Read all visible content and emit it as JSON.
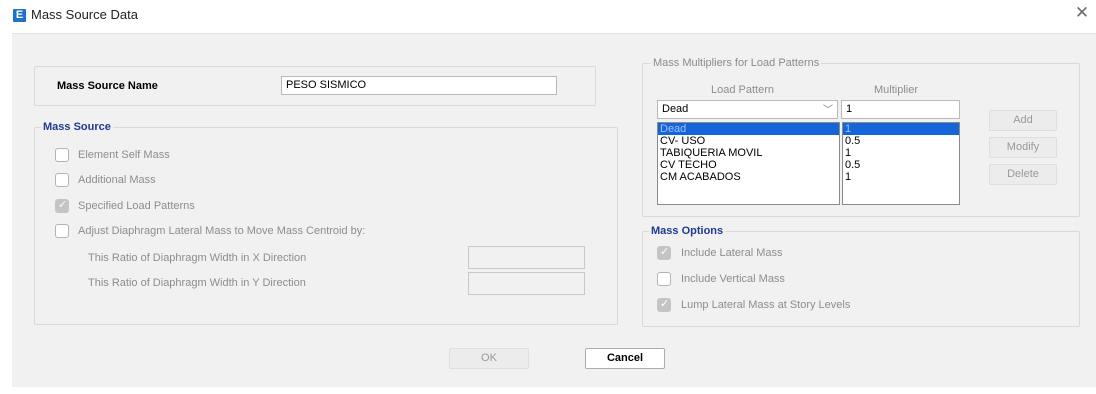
{
  "window": {
    "app_icon": "E",
    "title": "Mass Source Data",
    "close_glyph": "✕"
  },
  "mass_source_name": {
    "label": "Mass Source Name",
    "value": "PESO SISMICO"
  },
  "mass_source": {
    "legend": "Mass Source",
    "element_self_mass": {
      "label": "Element Self Mass",
      "checked": false
    },
    "additional_mass": {
      "label": "Additional Mass",
      "checked": false
    },
    "specified_load_patterns": {
      "label": "Specified Load Patterns",
      "checked": true
    },
    "adjust_diaphragm": {
      "label": "Adjust Diaphragm Lateral Mass to Move Mass Centroid by:",
      "checked": false
    },
    "ratio_x_label": "This Ratio of Diaphragm Width in X Direction",
    "ratio_x_value": "",
    "ratio_y_label": "This Ratio of Diaphragm Width in Y Direction",
    "ratio_y_value": ""
  },
  "multipliers": {
    "legend": "Mass Multipliers for Load Patterns",
    "col_load_pattern": "Load Pattern",
    "col_multiplier": "Multiplier",
    "pattern_selected": "Dead",
    "multiplier_value": "1",
    "rows": [
      {
        "pattern": "Dead",
        "multiplier": "1"
      },
      {
        "pattern": "CV- USO",
        "multiplier": "0.5"
      },
      {
        "pattern": "TABIQUERIA MOVIL",
        "multiplier": "1"
      },
      {
        "pattern": "CV TECHO",
        "multiplier": "0.5"
      },
      {
        "pattern": "CM ACABADOS",
        "multiplier": "1"
      }
    ],
    "add_label": "Add",
    "modify_label": "Modify",
    "delete_label": "Delete"
  },
  "mass_options": {
    "legend": "Mass Options",
    "include_lateral": {
      "label": "Include Lateral Mass",
      "checked": true
    },
    "include_vertical": {
      "label": "Include Vertical Mass",
      "checked": false
    },
    "lump_lateral": {
      "label": "Lump Lateral Mass at Story Levels",
      "checked": true
    }
  },
  "buttons": {
    "ok": "OK",
    "cancel": "Cancel"
  },
  "colors": {
    "selection": "#1565d8",
    "group_title": "#1f3a8f",
    "app_icon": "#1e73c8"
  }
}
